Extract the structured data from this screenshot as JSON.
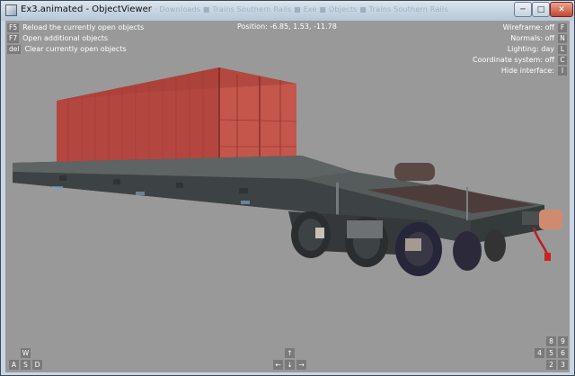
{
  "window": {
    "title": "Ex3.animated - ObjectViewer",
    "background_tabs": "— · Downloads  ■  Trains  Southern Rails  ■  Exe  ■  Objects  ■  Trains Southern Rails",
    "minimize_glyph": "─",
    "maximize_glyph": "□",
    "close_glyph": "✕"
  },
  "commands": [
    {
      "key": "F5",
      "label": "Reload the currently open objects"
    },
    {
      "key": "F7",
      "label": "Open additional objects"
    },
    {
      "key": "del",
      "label": "Clear currently open objects"
    }
  ],
  "position_text": "Position: -6.85, 1.53, -11.78",
  "toggles": [
    {
      "label": "Wireframe: off",
      "key": "F"
    },
    {
      "label": "Normals: off",
      "key": "N"
    },
    {
      "label": "Lighting: day",
      "key": "L"
    },
    {
      "label": "Coordinate system: off",
      "key": "C"
    },
    {
      "label": "Hide interface:",
      "key": "I"
    }
  ],
  "nav_keys_left": {
    "up": "W",
    "left": "A",
    "down": "S",
    "right": "D"
  },
  "nav_keys_center": {
    "up": "↑",
    "left": "←",
    "down": "↓",
    "right": "→"
  },
  "numpad_keys": {
    "row1": [
      "8",
      "9"
    ],
    "row2": [
      "4",
      "5",
      "6"
    ],
    "row3": [
      "2",
      "3"
    ]
  },
  "colors": {
    "viewport_bg": "#999999",
    "container": "#b5423a",
    "wagon": "#43484a",
    "hud_key_bg": "#7a7a7a",
    "titlebar": "#c9d5e2"
  },
  "icons": [
    "app-icon",
    "minimize-icon",
    "maximize-icon",
    "close-icon"
  ]
}
